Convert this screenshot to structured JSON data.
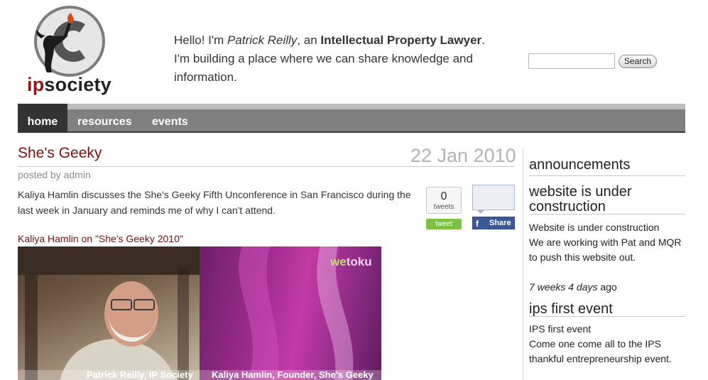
{
  "header": {
    "logo_prefix": "ip",
    "logo_suffix": "society",
    "intro_hello": "Hello! I'm ",
    "intro_name": "Patrick Reilly",
    "intro_an": ", an ",
    "intro_role": "Intellectual Property Lawyer",
    "intro_period": ".",
    "intro_line2": "I'm building a place where we can share knowledge and information.",
    "search_value": "",
    "search_button": "Search"
  },
  "nav": {
    "items": [
      {
        "label": "home"
      },
      {
        "label": "resources"
      },
      {
        "label": "events"
      }
    ]
  },
  "post": {
    "title": "She's Geeky",
    "date": "22 Jan 2010",
    "meta": "posted by admin",
    "body": "Kaliya Hamlin discusses the She's Geeky Fifth Unconference in San Francisco during the last week in January and reminds me of why I can't attend.",
    "tweet_count": "0",
    "tweet_count_label": "tweets",
    "tweet_button": "tweet",
    "fb_share_icon": "f",
    "fb_share": "Share",
    "video_caption": "Kaliya Hamlin on \"She's Geeky 2010\"",
    "video_watermark_a": "we",
    "video_watermark_b": "toku",
    "video_label_left": "Patrick Reilly, IP Society",
    "video_label_right": "Kaliya Hamlin, Founder, She's Geeky"
  },
  "sidebar": {
    "announcements_heading": "announcements",
    "item1_title": "website is under construction",
    "item1_line1": "Website is under construction",
    "item1_line2": "We are working with Pat and MQR to push this website out.",
    "item1_ago_em": "7 weeks 4 days",
    "item1_ago_rest": " ago",
    "item2_title": "ips first event",
    "item2_line1": "IPS first event",
    "item2_line2": "Come one come all to the IPS thankful entrepreneurship event."
  },
  "colors": {
    "title_red": "#7a1010",
    "nav_gray": "#808080",
    "nav_active": "#333333",
    "tweet_green": "#7cc343",
    "facebook_blue": "#3b5998"
  }
}
